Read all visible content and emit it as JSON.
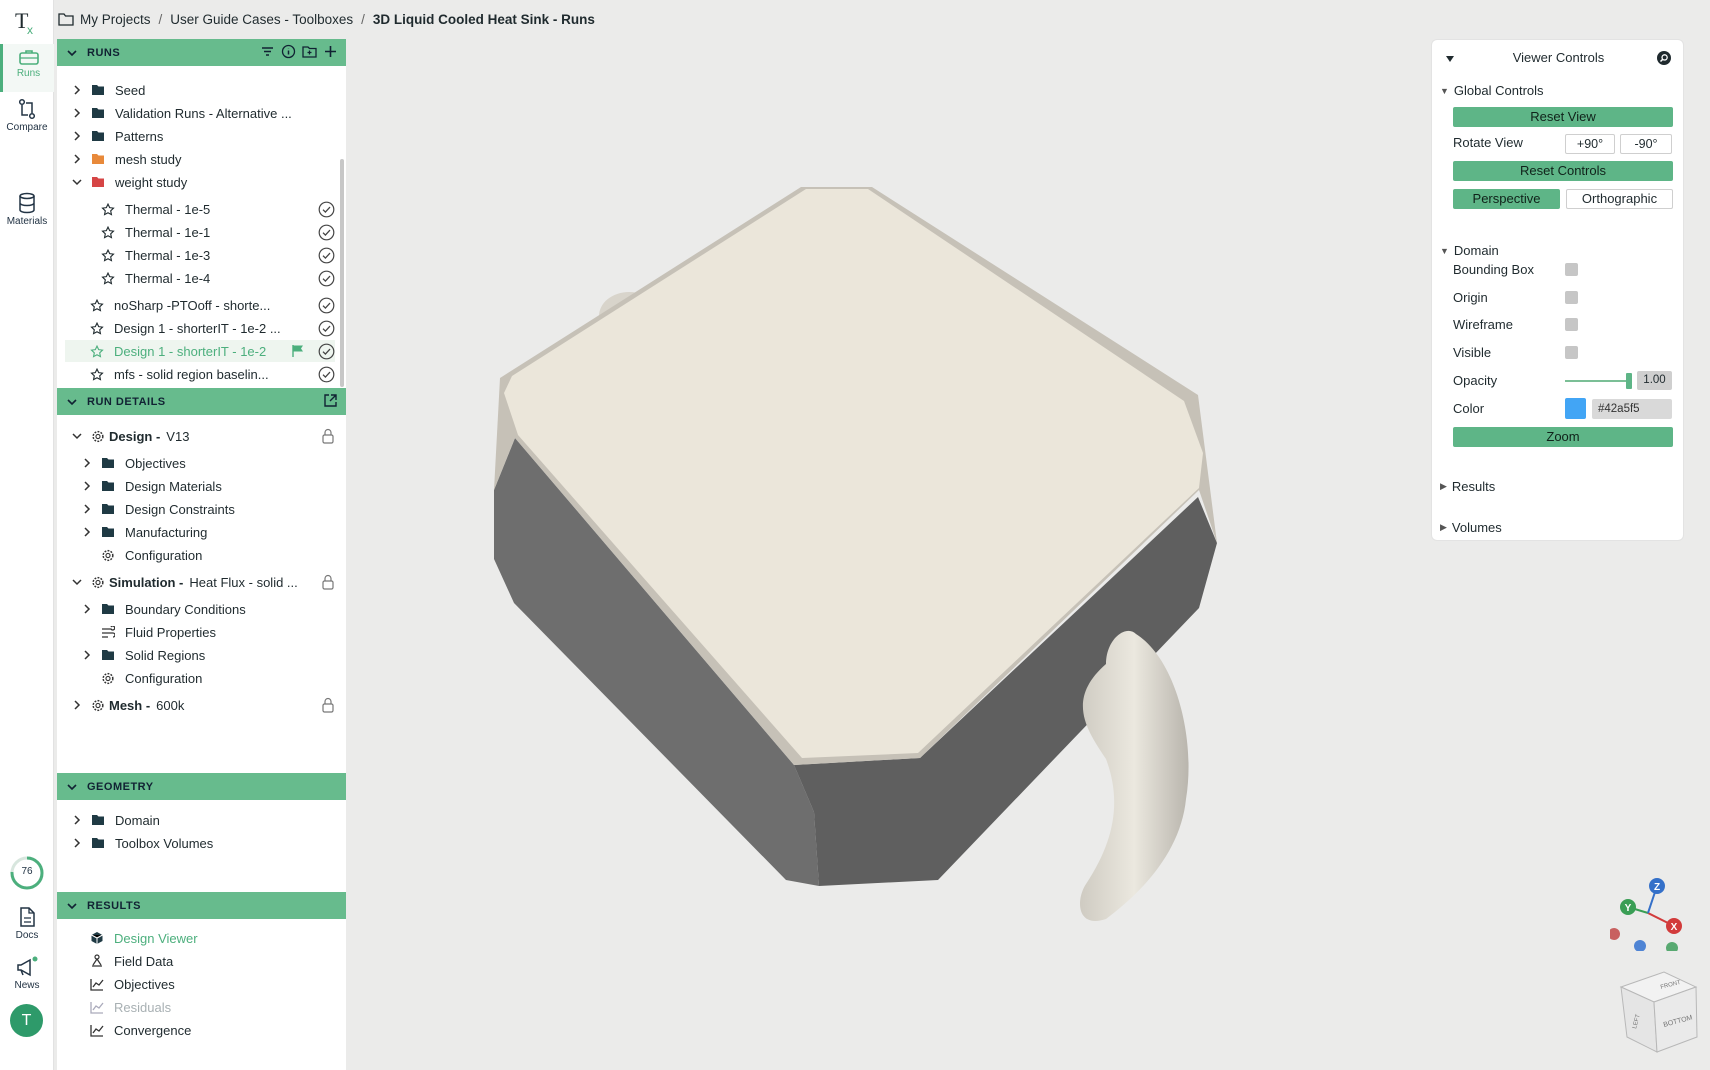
{
  "app": {
    "logo_text": "TX"
  },
  "breadcrumb": {
    "items": [
      "My Projects",
      "User Guide Cases - Toolboxes",
      "3D Liquid Cooled Heat Sink - Runs"
    ]
  },
  "rail": {
    "items": [
      {
        "label": "Runs",
        "active": true
      },
      {
        "label": "Compare"
      },
      {
        "label": "Materials"
      }
    ],
    "progress": "76",
    "docs_label": "Docs",
    "news_label": "News",
    "avatar_letter": "T"
  },
  "runs": {
    "title": "RUNS",
    "items": [
      {
        "label": "Seed"
      },
      {
        "label": "Validation Runs - Alternative ..."
      },
      {
        "label": "Patterns"
      },
      {
        "label": "mesh study",
        "folder_color": "#e8893a"
      },
      {
        "label": "weight study",
        "folder_color": "#d64545"
      },
      {
        "label": "Thermal - 1e-5"
      },
      {
        "label": "Thermal - 1e-1"
      },
      {
        "label": "Thermal - 1e-3"
      },
      {
        "label": "Thermal - 1e-4"
      },
      {
        "label": "noSharp -PTOoff - shorte..."
      },
      {
        "label": "Design 1 - shorterIT - 1e-2 ..."
      },
      {
        "label": "Design 1 - shorterIT - 1e-2",
        "selected": true
      },
      {
        "label": "mfs - solid region baselin..."
      }
    ]
  },
  "run_details": {
    "title": "RUN DETAILS",
    "design": {
      "label": "Design -",
      "value": "V13"
    },
    "design_items": [
      "Objectives",
      "Design Materials",
      "Design Constraints",
      "Manufacturing",
      "Configuration"
    ],
    "simulation": {
      "label": "Simulation -",
      "value": "Heat Flux - solid ..."
    },
    "simulation_items": [
      "Boundary Conditions",
      "Fluid Properties",
      "Solid Regions",
      "Configuration"
    ],
    "mesh": {
      "label": "Mesh -",
      "value": "600k"
    }
  },
  "geometry": {
    "title": "GEOMETRY",
    "items": [
      "Domain",
      "Toolbox Volumes"
    ]
  },
  "results": {
    "title": "RESULTS",
    "items": [
      "Design Viewer",
      "Field Data",
      "Objectives",
      "Residuals",
      "Convergence"
    ]
  },
  "viewer_controls": {
    "title": "Viewer Controls",
    "global_controls": "Global Controls",
    "reset_view": "Reset View",
    "rotate_view": "Rotate View",
    "rot_plus": "+90°",
    "rot_minus": "-90°",
    "reset_controls": "Reset Controls",
    "perspective": "Perspective",
    "orthographic": "Orthographic",
    "domain": "Domain",
    "bounding_box": "Bounding Box",
    "origin": "Origin",
    "wireframe": "Wireframe",
    "visible": "Visible",
    "opacity": "Opacity",
    "opacity_value": "1.00",
    "color": "Color",
    "color_value": "#42a5f5",
    "zoom": "Zoom",
    "results": "Results",
    "volumes": "Volumes"
  },
  "axes": {
    "x": "X",
    "y": "Y",
    "z": "Z"
  },
  "view_cube": {
    "front": "FRONT",
    "left": "LEFT",
    "bottom": "BOTTOM"
  }
}
